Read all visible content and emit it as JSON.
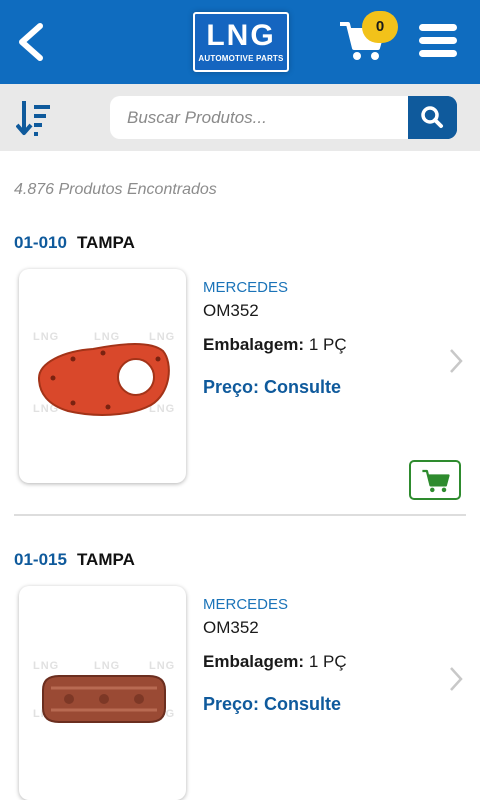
{
  "header": {
    "logo_main": "LNG",
    "logo_sub": "AUTOMOTIVE PARTS",
    "cart_count": "0",
    "icons": [
      "back-arrow-icon",
      "cart-icon",
      "menu-icon"
    ],
    "color": "#0f6cbf"
  },
  "search": {
    "placeholder": "Buscar Produtos...",
    "value": ""
  },
  "results": {
    "count_text": "4.876 Produtos Encontrados"
  },
  "products": [
    {
      "code": "01-010",
      "name": "TAMPA",
      "brand": "MERCEDES",
      "model": "OM352",
      "pack_label": "Embalagem:",
      "pack_value": "1 PÇ",
      "price": "Preço: Consulte"
    },
    {
      "code": "01-015",
      "name": "TAMPA",
      "brand": "MERCEDES",
      "model": "OM352",
      "pack_label": "Embalagem:",
      "pack_value": "1 PÇ",
      "price": "Preço: Consulte"
    }
  ],
  "watermark": "LNG"
}
